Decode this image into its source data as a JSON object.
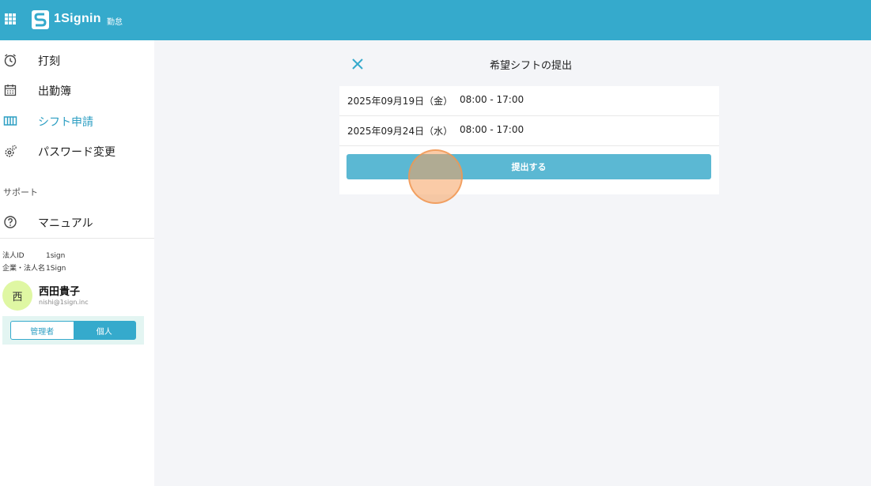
{
  "header": {
    "app_name": "1Signin",
    "app_sub": "勤怠"
  },
  "sidebar": {
    "items": [
      {
        "label": "打刻",
        "icon": "clock-icon"
      },
      {
        "label": "出勤簿",
        "icon": "calendar-icon"
      },
      {
        "label": "シフト申請",
        "icon": "shift-icon",
        "active": true
      },
      {
        "label": "パスワード変更",
        "icon": "gear-icon"
      }
    ],
    "support_label": "サポート",
    "support_items": [
      {
        "label": "マニュアル",
        "icon": "help-icon"
      }
    ]
  },
  "account": {
    "corp_id_label": "法人ID",
    "corp_id": "1sign",
    "corp_name_label": "企業・法人名",
    "corp_name": "1Sign",
    "avatar_char": "西",
    "user_name": "西田貴子",
    "user_email": "nishi@1sign.inc",
    "roles": [
      "管理者",
      "個人"
    ],
    "selected_role": "個人"
  },
  "dialog": {
    "title": "希望シフトの提出",
    "shifts": [
      {
        "date": "2025年09月19日（金）",
        "time": "08:00 - 17:00"
      },
      {
        "date": "2025年09月24日（水）",
        "time": "08:00 - 17:00"
      }
    ],
    "submit_label": "提出する"
  },
  "colors": {
    "brand": "#35aacc",
    "active_text": "#2e9fc3",
    "submit": "#5bb8d3"
  }
}
